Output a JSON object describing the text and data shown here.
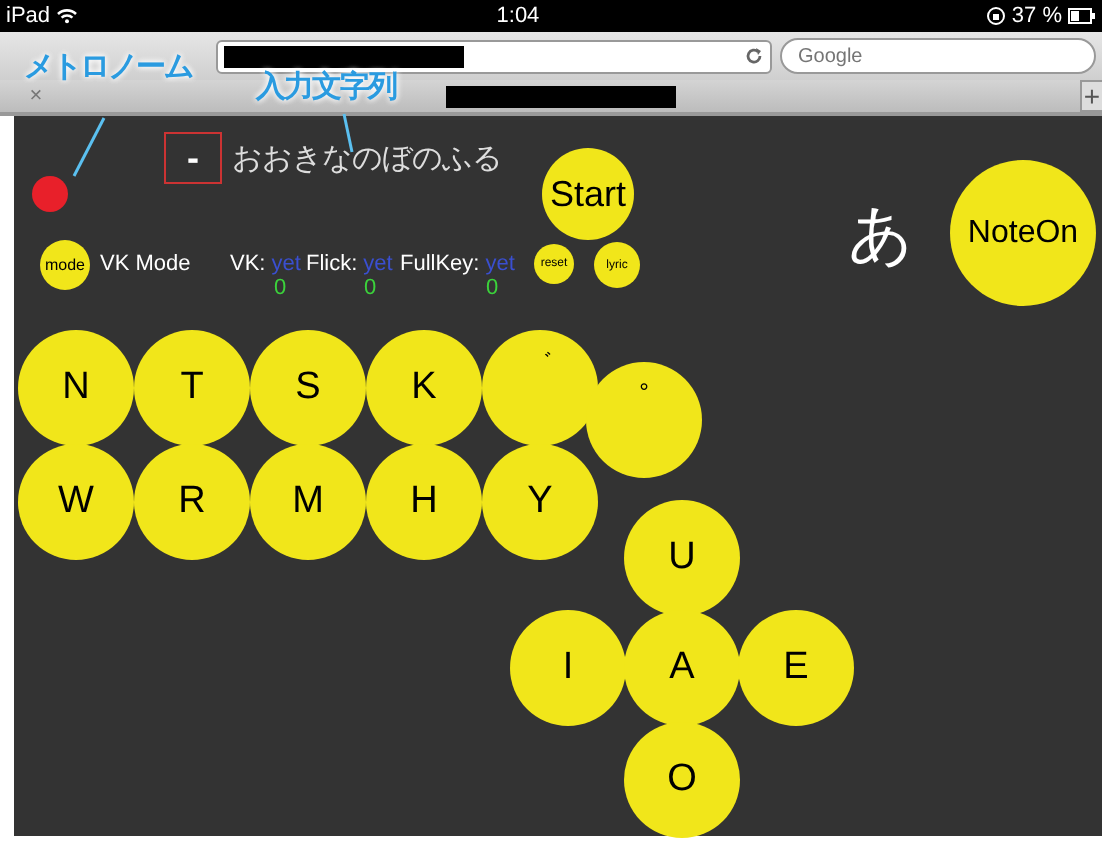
{
  "status_bar": {
    "device": "iPad",
    "time": "1:04",
    "battery": "37 %"
  },
  "browser": {
    "search_placeholder": "Google",
    "tab_close": "×",
    "new_tab": "+"
  },
  "annotations": [
    {
      "text": "メトロノーム"
    },
    {
      "text": "入力文字列"
    }
  ],
  "app": {
    "delete_key": "-",
    "input_text": "おおきなのぼのふる",
    "start": "Start",
    "current_char": "あ",
    "note_on": "NoteOn",
    "mode_button": "mode",
    "mode_label": "VK Mode",
    "stats": [
      {
        "label": "VK:",
        "status": "yet",
        "count": "0"
      },
      {
        "label": "Flick:",
        "status": "yet",
        "count": "0"
      },
      {
        "label": "FullKey:",
        "status": "yet",
        "count": "0"
      }
    ],
    "reset": "reset",
    "lyric": "lyric",
    "keys": [
      {
        "label": "N",
        "kind": "consonant"
      },
      {
        "label": "T",
        "kind": "consonant"
      },
      {
        "label": "S",
        "kind": "consonant"
      },
      {
        "label": "K",
        "kind": "consonant"
      },
      {
        "label": "゛",
        "kind": "mark"
      },
      {
        "label": "W",
        "kind": "consonant"
      },
      {
        "label": "R",
        "kind": "consonant"
      },
      {
        "label": "M",
        "kind": "consonant"
      },
      {
        "label": "H",
        "kind": "consonant"
      },
      {
        "label": "Y",
        "kind": "consonant"
      },
      {
        "label": "°",
        "kind": "mark"
      },
      {
        "label": "U",
        "kind": "vowel"
      },
      {
        "label": "I",
        "kind": "vowel"
      },
      {
        "label": "A",
        "kind": "vowel"
      },
      {
        "label": "E",
        "kind": "vowel"
      },
      {
        "label": "O",
        "kind": "vowel"
      }
    ]
  }
}
